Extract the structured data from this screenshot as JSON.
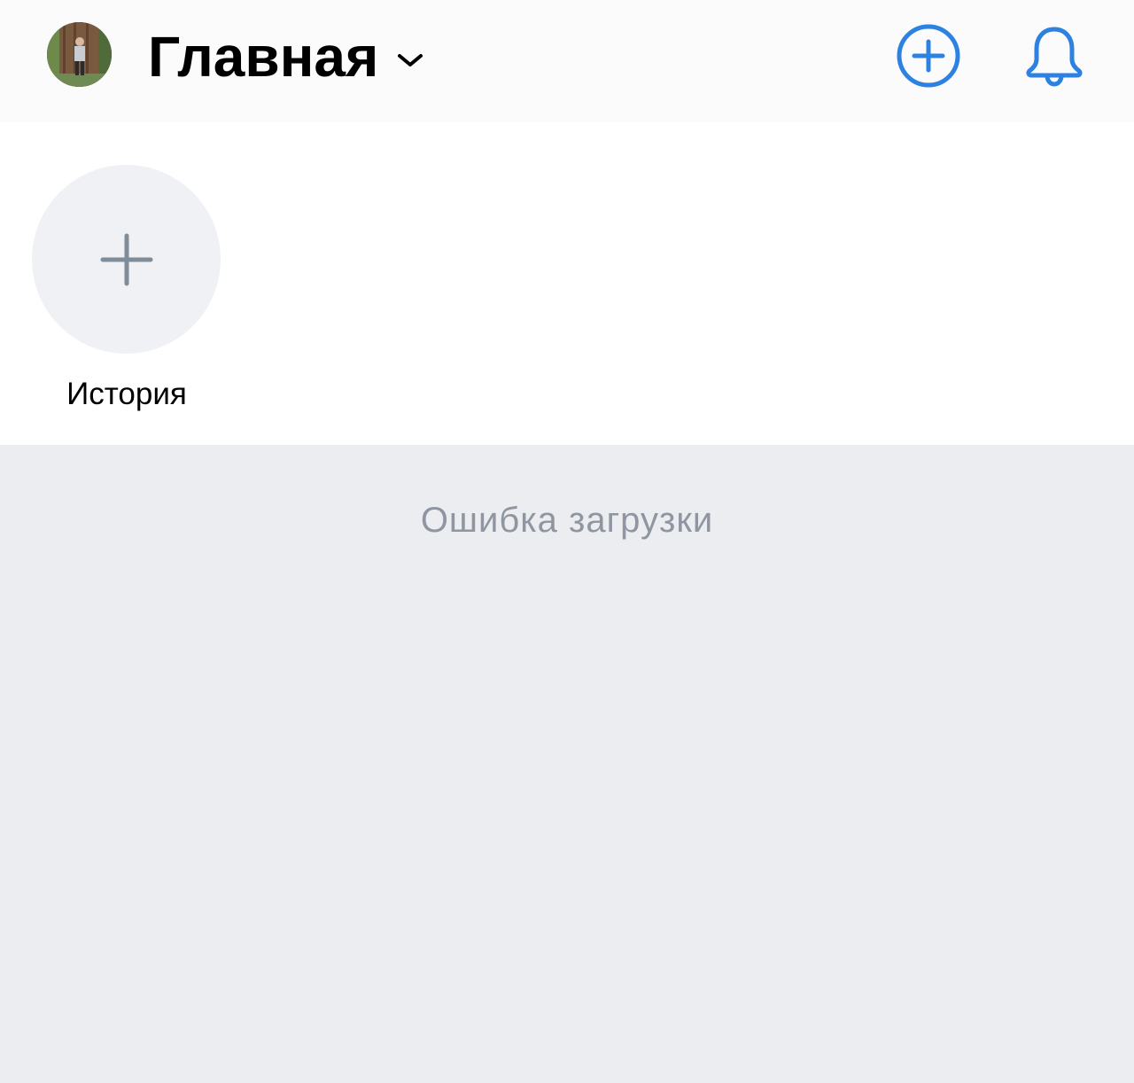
{
  "header": {
    "title": "Главная",
    "avatar_icon": "user-avatar",
    "chevron_icon": "chevron-down-icon",
    "add_icon": "plus-circle-icon",
    "bell_icon": "bell-icon",
    "accent_color": "#2d81e0"
  },
  "stories": {
    "items": [
      {
        "label": "История",
        "icon": "plus-icon"
      }
    ]
  },
  "feed": {
    "error_text": "Ошибка загрузки"
  }
}
